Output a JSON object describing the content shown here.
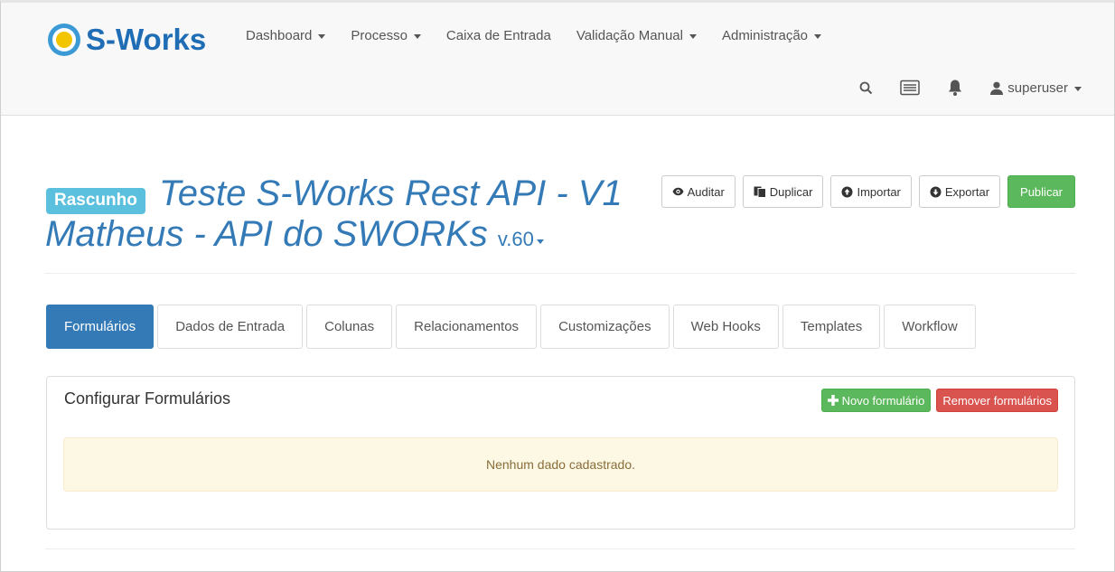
{
  "brand": {
    "name": "S-Works"
  },
  "nav": {
    "items": [
      {
        "label": "Dashboard",
        "dropdown": true
      },
      {
        "label": "Processo",
        "dropdown": true
      },
      {
        "label": "Caixa de Entrada",
        "dropdown": false
      },
      {
        "label": "Validação Manual",
        "dropdown": true
      },
      {
        "label": "Administração",
        "dropdown": true
      }
    ],
    "user": {
      "name": "superuser"
    },
    "icons": [
      "search-icon",
      "list-icon",
      "bell-icon",
      "user-icon"
    ]
  },
  "header": {
    "status_label": "Rascunho",
    "title": "Teste S-Works Rest API - V1 Matheus - API do SWORKs",
    "version": "v.60",
    "actions": [
      {
        "label": "Auditar",
        "icon": "eye-icon"
      },
      {
        "label": "Duplicar",
        "icon": "copy-icon"
      },
      {
        "label": "Importar",
        "icon": "circle-arrow-up-icon"
      },
      {
        "label": "Exportar",
        "icon": "circle-arrow-down-icon"
      }
    ],
    "publish_label": "Publicar"
  },
  "tabs": [
    {
      "label": "Formulários",
      "active": true
    },
    {
      "label": "Dados de Entrada"
    },
    {
      "label": "Colunas"
    },
    {
      "label": "Relacionamentos"
    },
    {
      "label": "Customizações"
    },
    {
      "label": "Web Hooks"
    },
    {
      "label": "Templates"
    },
    {
      "label": "Workflow"
    }
  ],
  "panel": {
    "title": "Configurar Formulários",
    "new_button": "Novo formulário",
    "remove_button": "Remover formulários",
    "empty_message": "Nenhum dado cadastrado."
  },
  "colors": {
    "primary": "#337ab7",
    "info": "#5bc0de",
    "success": "#5cb85c",
    "danger": "#d9534f",
    "warning_bg": "#fcf8e3"
  }
}
